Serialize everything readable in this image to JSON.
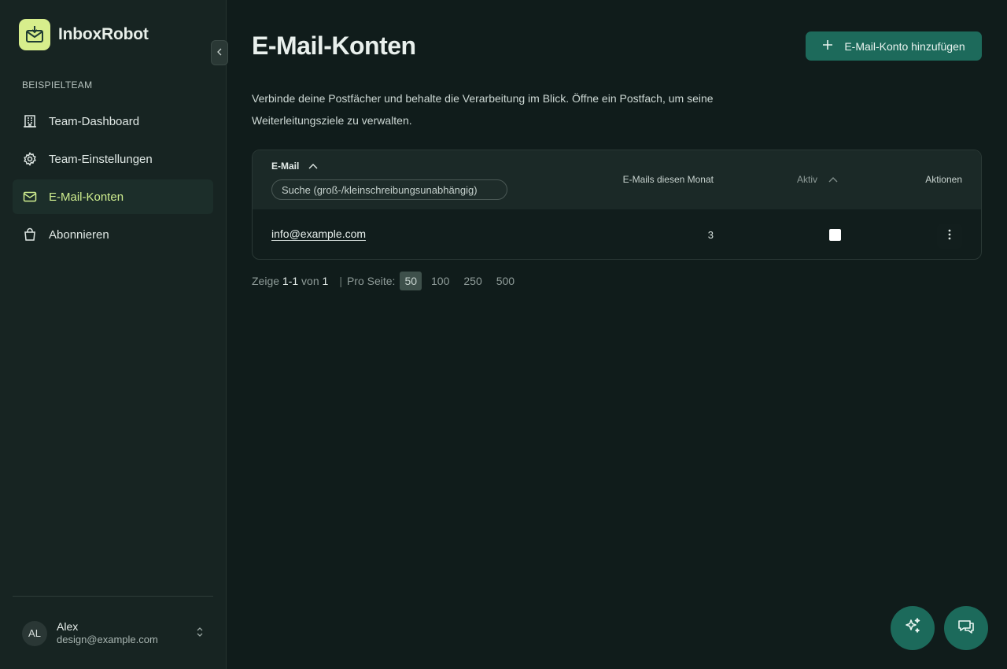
{
  "app": {
    "name": "InboxRobot"
  },
  "sidebar": {
    "team_label": "BEISPIELTEAM",
    "items": [
      {
        "label": "Team-Dashboard",
        "icon": "building-icon",
        "active": false
      },
      {
        "label": "Team-Einstellungen",
        "icon": "gear-icon",
        "active": false
      },
      {
        "label": "E-Mail-Konten",
        "icon": "mail-icon",
        "active": true
      },
      {
        "label": "Abonnieren",
        "icon": "shopping-bag-icon",
        "active": false
      }
    ],
    "user": {
      "initials": "AL",
      "name": "Alex",
      "email": "design@example.com"
    }
  },
  "main": {
    "title": "E-Mail-Konten",
    "add_button": "E-Mail-Konto hinzufügen",
    "description": "Verbinde deine Postfächer und behalte die Verarbeitung im Blick. Öffne ein Postfach, um seine Weiterleitungsziele zu verwalten.",
    "table": {
      "headers": {
        "email": "E-Mail",
        "count": "E-Mails diesen Monat",
        "active": "Aktiv",
        "actions": "Aktionen"
      },
      "search_placeholder": "Suche (groß-/kleinschreibungsunabhängig)",
      "rows": [
        {
          "email": "info@example.com",
          "count": "3",
          "active": true
        }
      ]
    },
    "pager": {
      "showing_prefix": "Zeige",
      "range": "1-1",
      "of": "von",
      "total": "1",
      "separator": "|",
      "per_page_label": "Pro Seite:",
      "options": [
        "50",
        "100",
        "250",
        "500"
      ],
      "selected": "50"
    }
  },
  "colors": {
    "accent": "#1d6a5b",
    "logo_bg": "#d7ee8c",
    "active_nav_text": "#cfee8f",
    "background": "#101c1b",
    "sidebar": "#172422"
  }
}
